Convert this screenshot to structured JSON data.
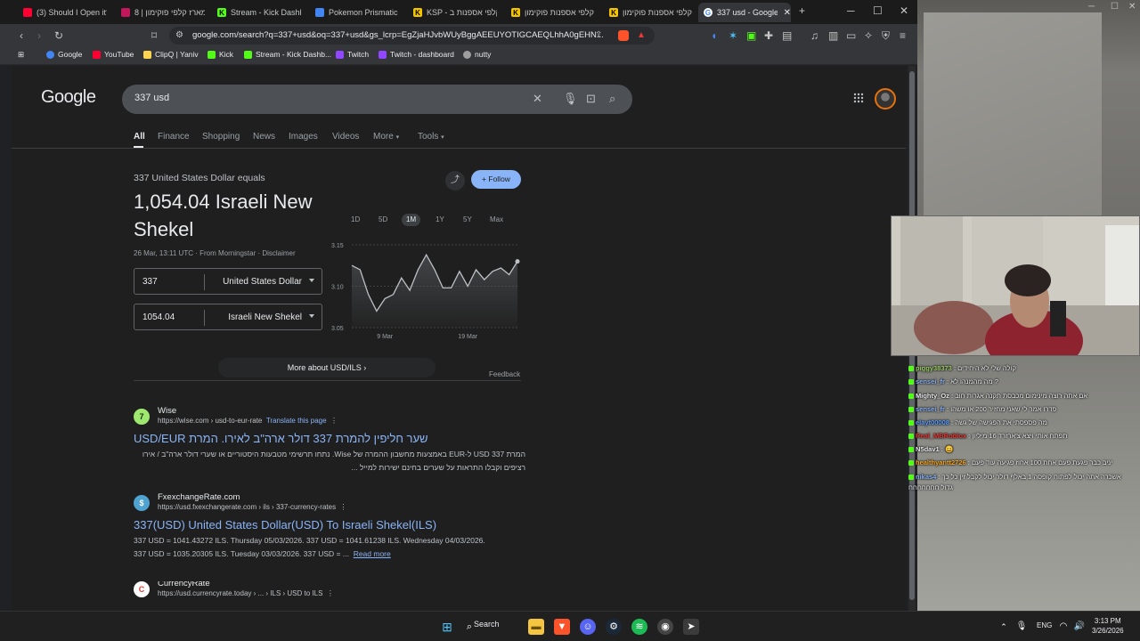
{
  "tabs": [
    {
      "label": "(3) Should I Open it?",
      "color": "#ff0033"
    },
    {
      "label": "מארז קלפי פוקימון | 8",
      "color": "#c2185b"
    },
    {
      "label": "Stream - Kick Dashbo",
      "color": "#53fc18"
    },
    {
      "label": "Pokemon Prismatic E",
      "color": "#4285f4"
    },
    {
      "label": "KSP - קלפי אספנות ב",
      "color": "#f5c400"
    },
    {
      "label": "קלפי אספנות פוקימון",
      "color": "#f5c400"
    },
    {
      "label": "קלפי אספנות פוקימון",
      "color": "#f5c400"
    },
    {
      "label": "337 usd - Google",
      "color": "#ffffff"
    }
  ],
  "toolbar": {
    "url": "google.com/search?q=337+usd&oq=337+usd&gs_lcrp=EgZjaHJvbWUyBggAEEUYOTIGCAEQLhhA0gEHN..."
  },
  "bookmarks": [
    {
      "label": "Google",
      "color": "#4285f4"
    },
    {
      "label": "YouTube",
      "color": "#ff0033"
    },
    {
      "label": "ClipQ | Yaniv",
      "color": "#ffd54f"
    },
    {
      "label": "Kick",
      "color": "#53fc18"
    },
    {
      "label": "Stream - Kick Dashb...",
      "color": "#53fc18"
    },
    {
      "label": "Twitch",
      "color": "#9146ff"
    },
    {
      "label": "Twitch - dashboard",
      "color": "#9146ff"
    },
    {
      "label": "nutty",
      "color": "#9e9e9e"
    }
  ],
  "google": {
    "logo": "Google",
    "query": "337 usd",
    "nav_tabs": [
      "All",
      "Finance",
      "Shopping",
      "News",
      "Images",
      "Videos",
      "More",
      "Tools"
    ]
  },
  "converter": {
    "equals_text": "337 United States Dollar equals",
    "result": "1,054.04 Israeli New Shekel",
    "date_text": "26 Mar, 13:11 UTC · From Morningstar · Disclaimer",
    "from_value": "337",
    "from_currency": "United States Dollar",
    "to_value": "1054.04",
    "to_currency": "Israeli New Shekel",
    "follow_label": "Follow",
    "ranges": [
      "1D",
      "5D",
      "1M",
      "1Y",
      "5Y",
      "Max"
    ],
    "active_range": "1M",
    "more_about": "More about USD/ILS",
    "feedback": "Feedback"
  },
  "chart_data": {
    "type": "line",
    "x": [
      0,
      1,
      2,
      3,
      4,
      5,
      6,
      7,
      8,
      9,
      10,
      11,
      12,
      13,
      14,
      15,
      16,
      17,
      18,
      19,
      20
    ],
    "values": [
      3.125,
      3.12,
      3.09,
      3.07,
      3.085,
      3.09,
      3.11,
      3.095,
      3.12,
      3.138,
      3.12,
      3.098,
      3.098,
      3.118,
      3.1,
      3.12,
      3.108,
      3.118,
      3.122,
      3.114,
      3.13
    ],
    "x_tick_labels": [
      "9 Mar",
      "19 Mar"
    ],
    "y_ticks": [
      "3.15",
      "3.10",
      "3.05"
    ],
    "ylim": [
      3.05,
      3.15
    ],
    "color": "#bdc1c6"
  },
  "results": [
    {
      "site": "Wise",
      "url": "https://wise.com › usd-to-eur-rate",
      "translate": "Translate this page",
      "title": "שער חליפין להמרת 337 דולר ארה\"ב לאירו. המרת USD/EUR",
      "snippet": "המרת 337 USD ל-EUR באמצעות מחשבון ההמרה של Wise. נתחו תרשימי מטבעות היסטוריים או שערי דולר ארה\"ב / אירו רציפים וקבלו התראות על שערים בחינם ישירות למייל ...",
      "fav_color": "#9fe870",
      "fav_text": "7"
    },
    {
      "site": "FxexchangeRate.com",
      "url": "https://usd.fxexchangerate.com › ils › 337-currency-rates",
      "title": "337(USD) United States Dollar(USD) To Israeli Shekel(ILS)",
      "snippet_1": "337 USD = 1041.43272 ILS. Thursday 05/03/2026. 337 USD = 1041.61238 ILS. Wednesday 04/03/2026.",
      "snippet_2": "337 USD = 1035.20305 ILS. Tuesday 03/03/2026. 337 USD = ...",
      "read_more": "Read more",
      "fav_color": "#4fa3d1",
      "fav_text": "$"
    },
    {
      "site": "CurrencyRate",
      "url": "https://usd.currencyrate.today › ... › ILS › USD to ILS",
      "fav_color": "#e53935",
      "fav_text": "C"
    }
  ],
  "chat": [
    {
      "user": "piggy38373",
      "text": "קולה שלי לא היחידים",
      "color": "#9ccc65"
    },
    {
      "user": "sensei_fr",
      "text": "מה מהמנהו לא ?",
      "color": "#8ab4f8"
    },
    {
      "user": "Mighty_Oz",
      "text": "אם אתה רוצה מינימום מכבסת תקנה אגרות חוב",
      "color": "#e8eaed"
    },
    {
      "user": "sensei_fr",
      "text": "פדרו אמר לי שאני מחזיר 200 או משהו",
      "color": "#8ab4f8"
    },
    {
      "user": "elayt00008",
      "text": "מה פספסתי את הפגישה של גשה",
      "color": "#5b9cff"
    },
    {
      "user": "Real_MBRoblox",
      "text": "תפתח אותי ויצא צ'ארזרד 16 מיליון",
      "color": "#e53935"
    },
    {
      "user": "N5dav1",
      "text": "😄",
      "color": "#e8eaed"
    },
    {
      "user": "healthyantt2726",
      "text": "יניב כבר פגעת פעם אחת 100 אחוז פגיעה עוד פעם",
      "color": "#f5a623"
    },
    {
      "user": "nikas4",
      "text": "אשכרה אתה יכול לפתוח קופסה 1 באלף דולר יכול לקבל זין כל כך גדול חחחחחחח",
      "color": "#8ab4f8"
    }
  ],
  "taskbar": {
    "search_label": "Search",
    "lang": "ENG",
    "time": "3:13 PM",
    "date": "3/26/2026"
  }
}
